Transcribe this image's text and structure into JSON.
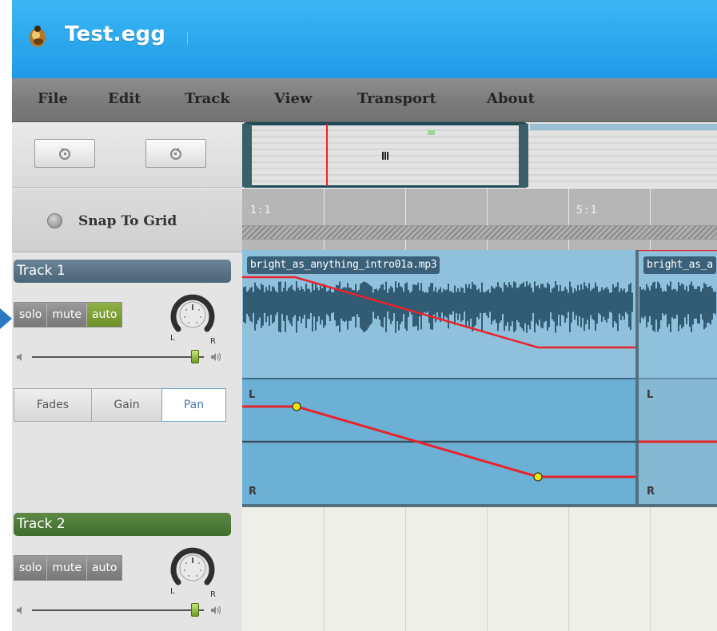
{
  "app": {
    "title": "Test.egg"
  },
  "menu": [
    {
      "label": "File"
    },
    {
      "label": "Edit"
    },
    {
      "label": "Track"
    },
    {
      "label": "View"
    },
    {
      "label": "Transport"
    },
    {
      "label": "About"
    }
  ],
  "toolbar": {
    "undo_icon": "undo-icon",
    "redo_icon": "redo-icon"
  },
  "snap": {
    "label": "Snap To Grid",
    "enabled": false
  },
  "ruler": {
    "labels": [
      "1:1",
      "5:1"
    ]
  },
  "tracks": [
    {
      "name": "Track 1",
      "name_color": "#4a6577",
      "buttons": {
        "solo": "solo",
        "mute": "mute",
        "auto": "auto"
      },
      "auto_active": true,
      "pan_left": "L",
      "pan_right": "R",
      "volume": 0.95,
      "automation_tabs": [
        "Fades",
        "Gain",
        "Pan"
      ],
      "active_tab": "Pan",
      "clips": [
        {
          "name": "bright_as_anything_intro01a.mp3"
        },
        {
          "name": "bright_as_a"
        }
      ],
      "automation_labels": {
        "top": "L",
        "bottom": "R"
      }
    },
    {
      "name": "Track 2",
      "name_color": "#3f6d2d",
      "buttons": {
        "solo": "solo",
        "mute": "mute",
        "auto": "auto"
      },
      "auto_active": false,
      "pan_left": "L",
      "pan_right": "R",
      "volume": 0.95
    }
  ],
  "colors": {
    "titlebar": "#1f9be6",
    "automation_line": "#e8242a",
    "automation_point": "#f2e600",
    "waveform": "#123a52",
    "clip_background": "#8fc0dc"
  }
}
